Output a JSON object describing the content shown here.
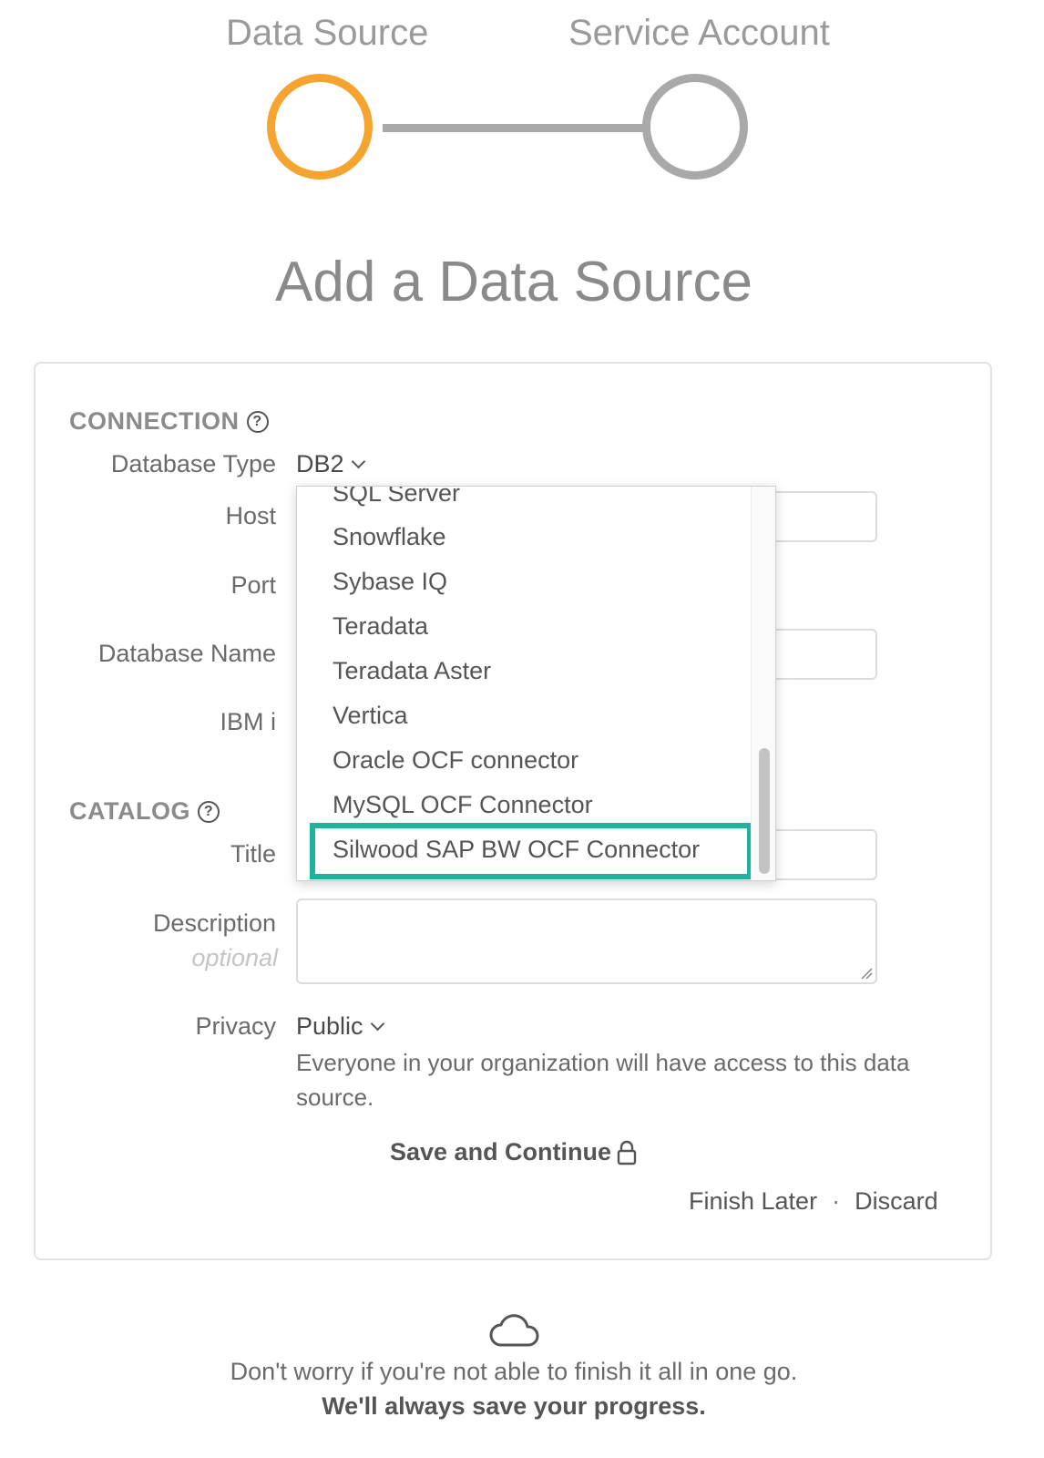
{
  "stepper": {
    "steps": [
      {
        "label": "Data Source",
        "state": "active",
        "color": "#F5A430"
      },
      {
        "label": "Service Account",
        "state": "pending",
        "color": "#A9A9A9"
      }
    ]
  },
  "page_title": "Add a Data Source",
  "connection": {
    "heading": "CONNECTION",
    "database_type_label": "Database Type",
    "database_type_value": "DB2",
    "host_label": "Host",
    "port_label": "Port",
    "database_name_label": "Database Name",
    "ibm_i_label": "IBM i"
  },
  "dropdown": {
    "items": [
      "SQL Server",
      "Snowflake",
      "Sybase IQ",
      "Teradata",
      "Teradata Aster",
      "Vertica",
      "Oracle OCF connector",
      "MySQL OCF Connector",
      "Silwood SAP BW OCF Connector"
    ],
    "highlighted_item": "Silwood SAP BW OCF Connector",
    "highlight_color": "#1FB39B"
  },
  "catalog": {
    "heading": "CATALOG",
    "title_label": "Title",
    "description_label": "Description",
    "description_hint": "optional",
    "privacy_label": "Privacy",
    "privacy_value": "Public",
    "privacy_help": "Everyone in your organization will have access to this data source."
  },
  "actions": {
    "save_label": "Save and Continue",
    "finish_later_label": "Finish Later",
    "separator": "·",
    "discard_label": "Discard"
  },
  "footer": {
    "line1": "Don't worry if you're not able to finish it all in one go.",
    "line2": "We'll always save your progress."
  }
}
